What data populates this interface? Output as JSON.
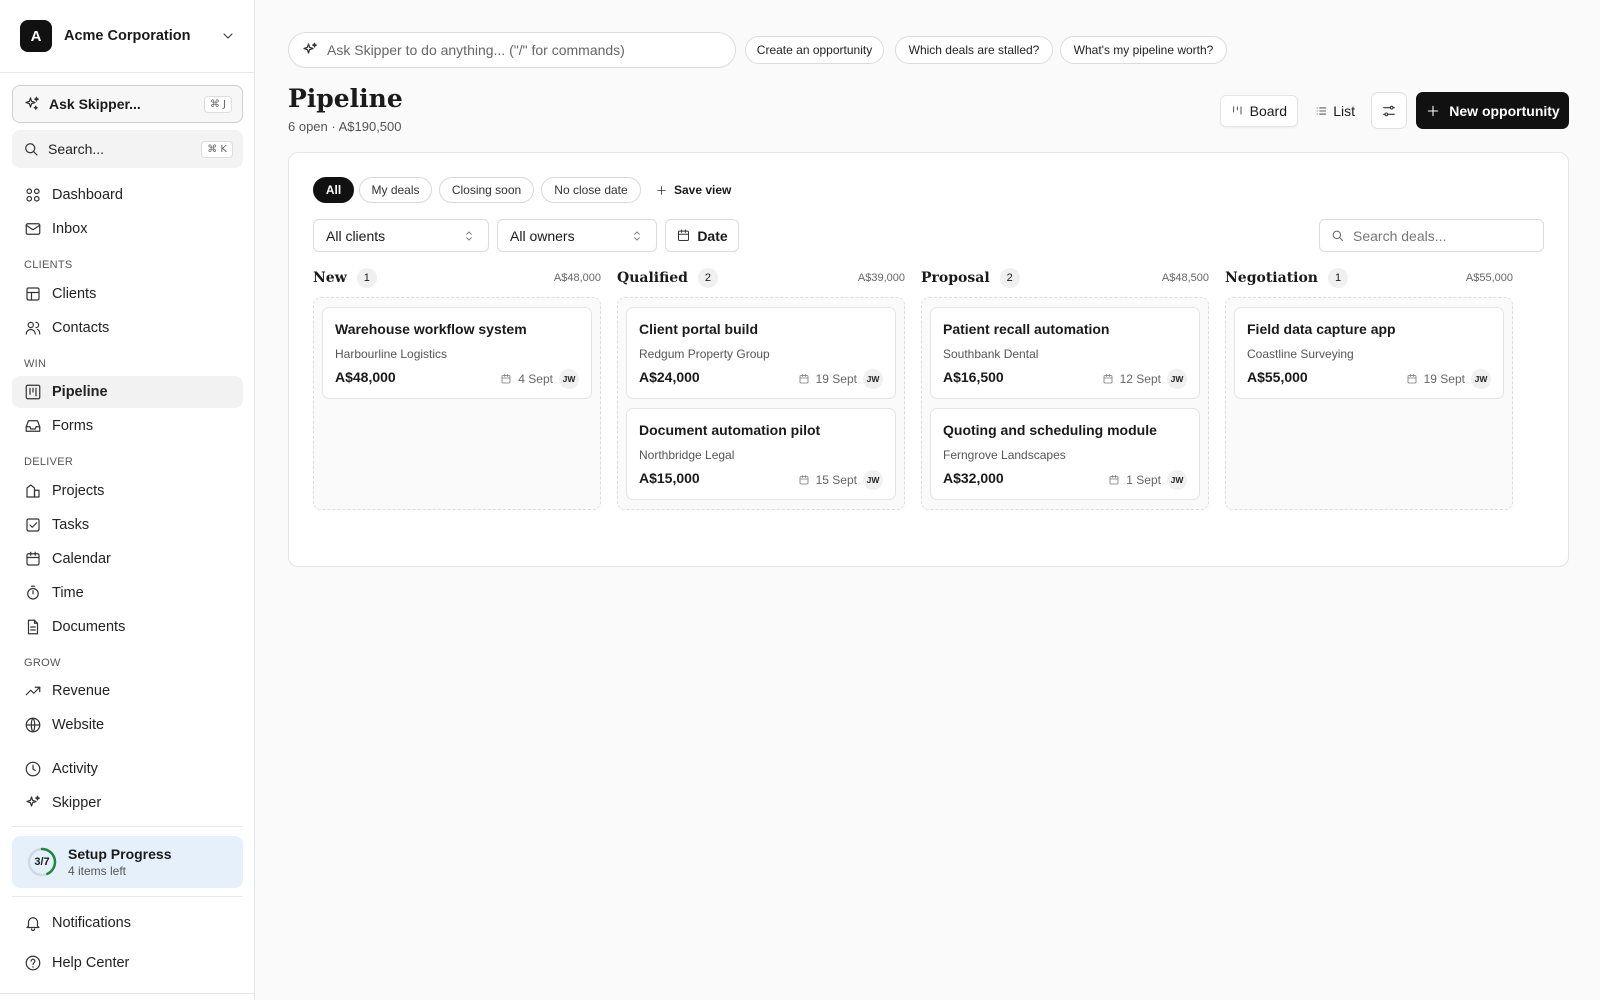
{
  "org": {
    "initial": "A",
    "name": "Acme Corporation"
  },
  "sidebar": {
    "ask": {
      "label": "Ask Skipper...",
      "shortcut": "⌘ J"
    },
    "search": {
      "label": "Search...",
      "shortcut": "⌘ K"
    },
    "nav": {
      "dashboard": "Dashboard",
      "inbox": "Inbox",
      "clients_section": "CLIENTS",
      "clients": "Clients",
      "contacts": "Contacts",
      "win_section": "WIN",
      "pipeline": "Pipeline",
      "forms": "Forms",
      "deliver_section": "DELIVER",
      "projects": "Projects",
      "tasks": "Tasks",
      "calendar": "Calendar",
      "time": "Time",
      "documents": "Documents",
      "grow_section": "GROW",
      "revenue": "Revenue",
      "website": "Website",
      "activity": "Activity",
      "skipper": "Skipper"
    },
    "setup": {
      "progress_label": "3/7",
      "progress": 0.43,
      "title": "Setup Progress",
      "subtitle": "4 items left"
    },
    "notifications": "Notifications",
    "help": "Help Center"
  },
  "topbar": {
    "command_placeholder": "Ask Skipper to do anything... (\"/\" for commands)",
    "suggestions": [
      "Create an opportunity",
      "Which deals are stalled?",
      "What's my pipeline worth?"
    ]
  },
  "header": {
    "title": "Pipeline",
    "subtitle": "6 open · A$190,500",
    "board_label": "Board",
    "list_label": "List",
    "new_button": "New opportunity"
  },
  "filters": {
    "pills": [
      "All",
      "My deals",
      "Closing soon",
      "No close date"
    ],
    "save_view": "Save view",
    "clients_select": "All clients",
    "owners_select": "All owners",
    "date_button": "Date",
    "search_placeholder": "Search deals..."
  },
  "columns": [
    {
      "name": "New",
      "count": "1",
      "total": "A$48,000",
      "cards": [
        {
          "title": "Warehouse workflow system",
          "client": "Harbourline Logistics",
          "value": "A$48,000",
          "date": "4 Sept",
          "owner": "JW"
        }
      ]
    },
    {
      "name": "Qualified",
      "count": "2",
      "total": "A$39,000",
      "cards": [
        {
          "title": "Client portal build",
          "client": "Redgum Property Group",
          "value": "A$24,000",
          "date": "19 Sept",
          "owner": "JW"
        },
        {
          "title": "Document automation pilot",
          "client": "Northbridge Legal",
          "value": "A$15,000",
          "date": "15 Sept",
          "owner": "JW"
        }
      ]
    },
    {
      "name": "Proposal",
      "count": "2",
      "total": "A$48,500",
      "cards": [
        {
          "title": "Patient recall automation",
          "client": "Southbank Dental",
          "value": "A$16,500",
          "date": "12 Sept",
          "owner": "JW"
        },
        {
          "title": "Quoting and scheduling module",
          "client": "Ferngrove Landscapes",
          "value": "A$32,000",
          "date": "1 Sept",
          "owner": "JW"
        }
      ]
    },
    {
      "name": "Negotiation",
      "count": "1",
      "total": "A$55,000",
      "cards": [
        {
          "title": "Field data capture app",
          "client": "Coastline Surveying",
          "value": "A$55,000",
          "date": "19 Sept",
          "owner": "JW"
        }
      ]
    }
  ]
}
